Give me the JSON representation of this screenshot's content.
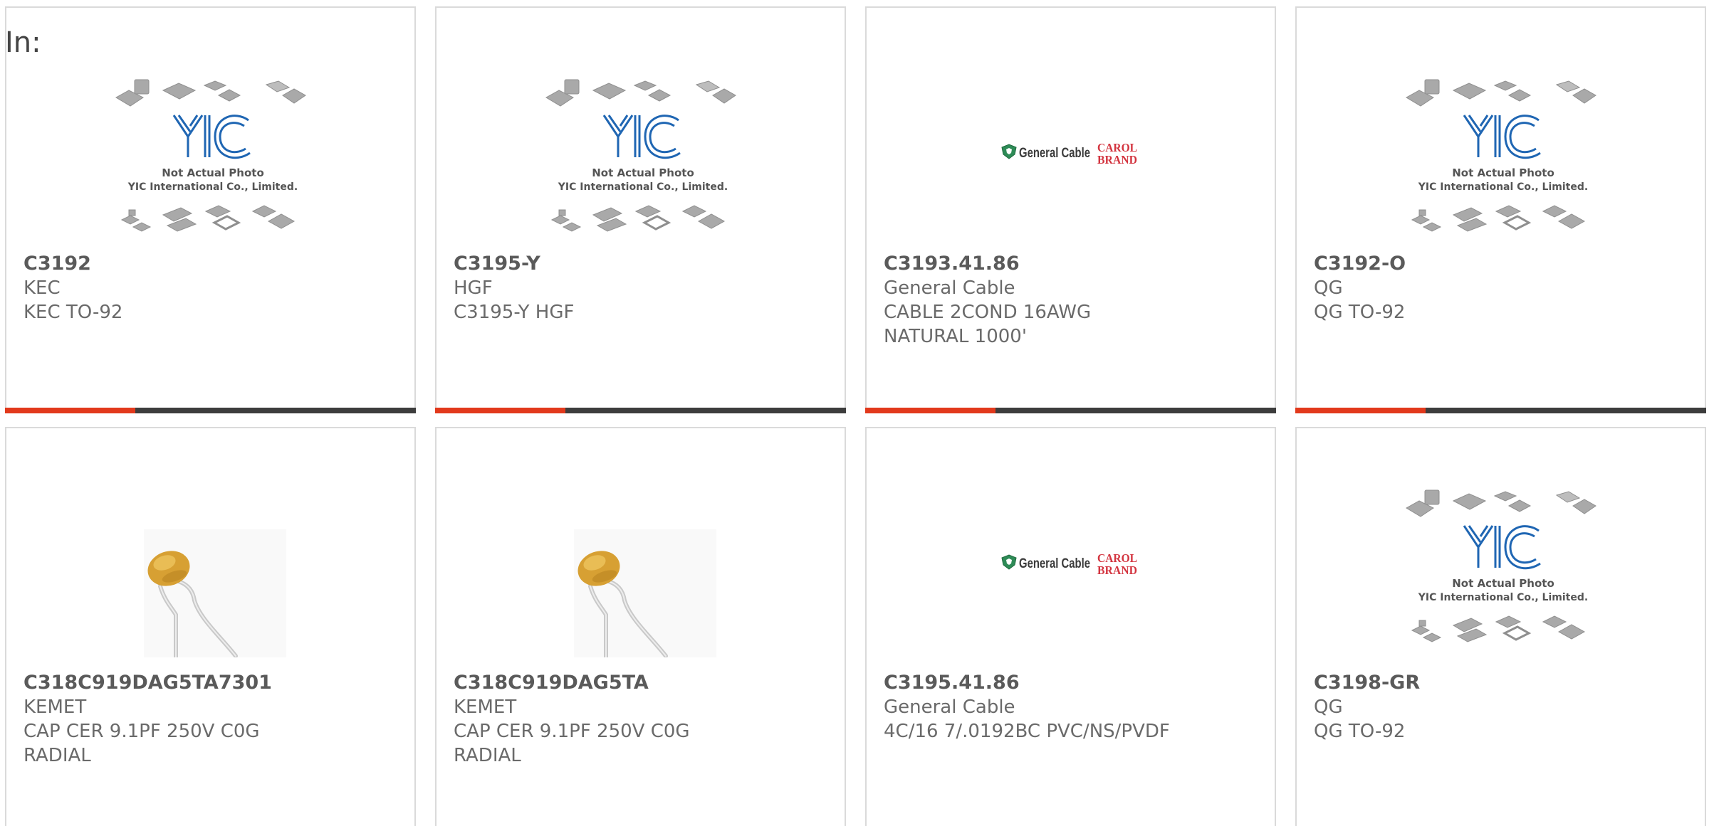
{
  "section_label": "In:",
  "colors": {
    "accent": "#e2391c",
    "bar": "#3d3d3d",
    "card_border": "#dadada"
  },
  "products": [
    {
      "part_number": "C3192",
      "manufacturer": "KEC",
      "description": "KEC TO-92",
      "image": "yic-placeholder",
      "image_caption_1": "Not Actual Photo",
      "image_caption_2": "YIC International Co., Limited."
    },
    {
      "part_number": "C3195-Y",
      "manufacturer": "HGF",
      "description": "C3195-Y HGF",
      "image": "yic-placeholder",
      "image_caption_1": "Not Actual Photo",
      "image_caption_2": "YIC International Co., Limited."
    },
    {
      "part_number": "C3193.41.86",
      "manufacturer": "General Cable",
      "description": "CABLE 2COND 16AWG NATURAL 1000'",
      "image": "general-cable-logo",
      "logo_text": "General Cable",
      "logo_brand_1": "CAROL",
      "logo_brand_2": "BRAND"
    },
    {
      "part_number": "C3192-O",
      "manufacturer": "QG",
      "description": "QG TO-92",
      "image": "yic-placeholder",
      "image_caption_1": "Not Actual Photo",
      "image_caption_2": "YIC International Co., Limited."
    },
    {
      "part_number": "C318C919DAG5TA7301",
      "manufacturer": "KEMET",
      "description": "CAP CER 9.1PF 250V C0G RADIAL",
      "image": "ceramic-capacitor"
    },
    {
      "part_number": "C318C919DAG5TA",
      "manufacturer": "KEMET",
      "description": "CAP CER 9.1PF 250V C0G RADIAL",
      "image": "ceramic-capacitor"
    },
    {
      "part_number": "C3195.41.86",
      "manufacturer": "General Cable",
      "description": "4C/16 7/.0192BC PVC/NS/PVDF",
      "image": "general-cable-logo",
      "logo_text": "General Cable",
      "logo_brand_1": "CAROL",
      "logo_brand_2": "BRAND"
    },
    {
      "part_number": "C3198-GR",
      "manufacturer": "QG",
      "description": "QG TO-92",
      "image": "yic-placeholder",
      "image_caption_1": "Not Actual Photo",
      "image_caption_2": "YIC International Co., Limited."
    }
  ]
}
